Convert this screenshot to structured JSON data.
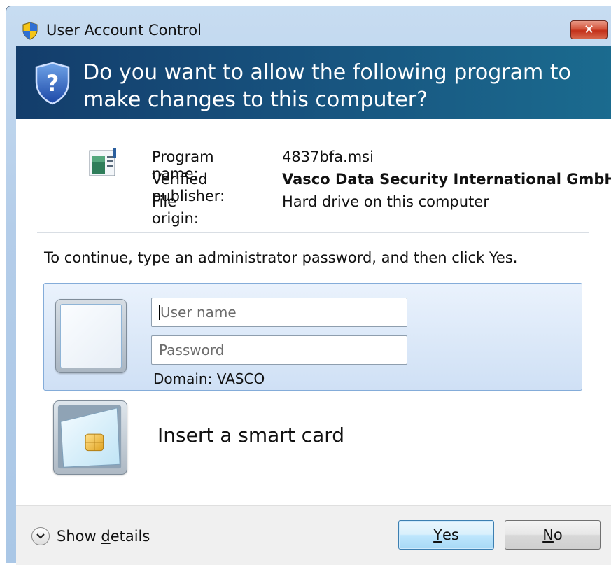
{
  "window": {
    "title": "User Account Control",
    "close_label": "✕"
  },
  "header": {
    "question": "Do you want to allow the following program to make changes to this computer?"
  },
  "program_info": {
    "rows": [
      {
        "label": "Program name:",
        "value": "4837bfa.msi",
        "bold": false
      },
      {
        "label": "Verified publisher:",
        "value": "Vasco Data Security International GmbH",
        "bold": true
      },
      {
        "label": "File origin:",
        "value": "Hard drive on this computer",
        "bold": false
      }
    ]
  },
  "instruction": "To continue, type an administrator password, and then click Yes.",
  "credentials": {
    "username_placeholder": "User name",
    "password_placeholder": "Password",
    "domain": "Domain: VASCO"
  },
  "smartcard": {
    "label": "Insert a smart card"
  },
  "footer": {
    "show_details": {
      "prefix": "Show ",
      "accel": "d",
      "suffix": "etails"
    },
    "yes": {
      "accel": "Y",
      "rest": "es"
    },
    "no": {
      "accel": "N",
      "rest": "o"
    }
  },
  "colors": {
    "header_band": "#17517d",
    "selected_panel": "#cfe0f5",
    "close_button": "#c3301a"
  },
  "icons": [
    "uac-shield-icon",
    "question-shield-icon",
    "program-icon",
    "user-tile-icon",
    "smart-card-icon",
    "chevron-down-icon",
    "close-icon"
  ]
}
